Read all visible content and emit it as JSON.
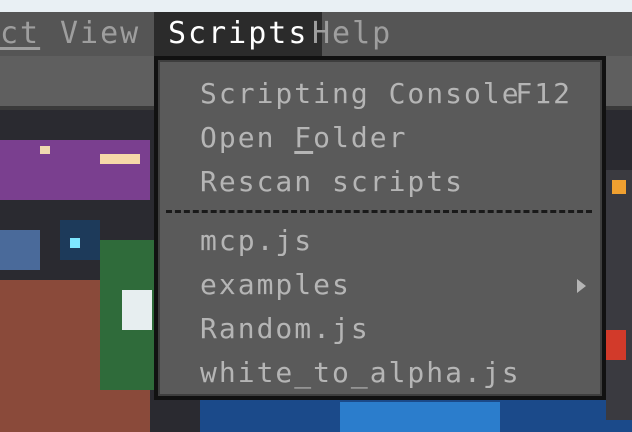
{
  "menubar": {
    "items": [
      {
        "label": "ct",
        "mnemonic_index": 1
      },
      {
        "label": "View",
        "mnemonic_index": 0
      },
      {
        "label": "Scripts",
        "mnemonic_index": 1,
        "active": true
      },
      {
        "label": "Help",
        "mnemonic_index": 0
      }
    ]
  },
  "scripts_menu": {
    "items": [
      {
        "label": "Scripting Console",
        "shortcut": "F12"
      },
      {
        "label_pre": "Open ",
        "label_mn": "F",
        "label_post": "older"
      },
      {
        "label": "Rescan scripts"
      },
      {
        "label": "mcp.js"
      },
      {
        "label": "examples",
        "has_submenu": true
      },
      {
        "label": "Random.js"
      },
      {
        "label": "white_to_alpha.js"
      }
    ]
  },
  "colors": {
    "menubar_bg": "#555555",
    "menubar_text": "#9e9e9e",
    "active_bg": "#2b2b2b",
    "active_text": "#ffffff",
    "menu_bg": "#5a5a5a",
    "menu_text": "#b5b5b5",
    "menu_border": "#111111"
  },
  "icons": {
    "submenu": "chevron-right-icon"
  }
}
